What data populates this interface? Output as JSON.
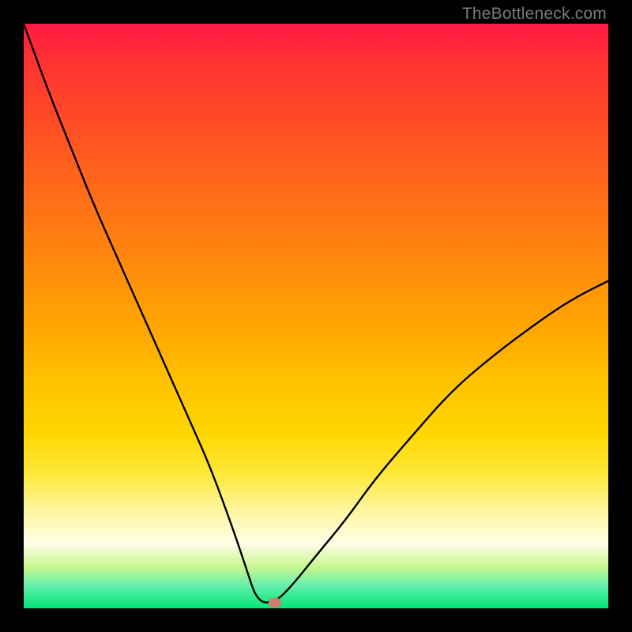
{
  "watermark": "TheBottleneck.com",
  "chart_data": {
    "type": "line",
    "title": "",
    "xlabel": "",
    "ylabel": "",
    "xlim": [
      0,
      100
    ],
    "ylim": [
      0,
      100
    ],
    "note": "V-shaped bottleneck curve over a red→yellow→green vertical gradient. Curve touches y≈0 with a short flat segment near x≈40–43. Left branch falls from (0,100) to the flat; right branch rises from the flat to (100,~56). A small rounded marker sits at the right end of the flat segment (~x=43, y≈1).",
    "series": [
      {
        "name": "bottleneck-curve",
        "x": [
          0,
          4,
          8,
          12,
          16,
          20,
          24,
          28,
          32,
          36,
          38,
          40,
          43,
          46,
          50,
          55,
          60,
          66,
          73,
          80,
          88,
          94,
          100
        ],
        "y": [
          100,
          89,
          79,
          69,
          60,
          51,
          42,
          33,
          24,
          13,
          7,
          1,
          1,
          4,
          9,
          15,
          22,
          29,
          37,
          43,
          49,
          53,
          56
        ]
      }
    ],
    "marker": {
      "x": 43,
      "y": 1
    },
    "gradient_stops": [
      {
        "pos": 0,
        "color": "#ff1744"
      },
      {
        "pos": 50,
        "color": "#ffab00"
      },
      {
        "pos": 85,
        "color": "#fffde7"
      },
      {
        "pos": 100,
        "color": "#00e676"
      }
    ]
  }
}
